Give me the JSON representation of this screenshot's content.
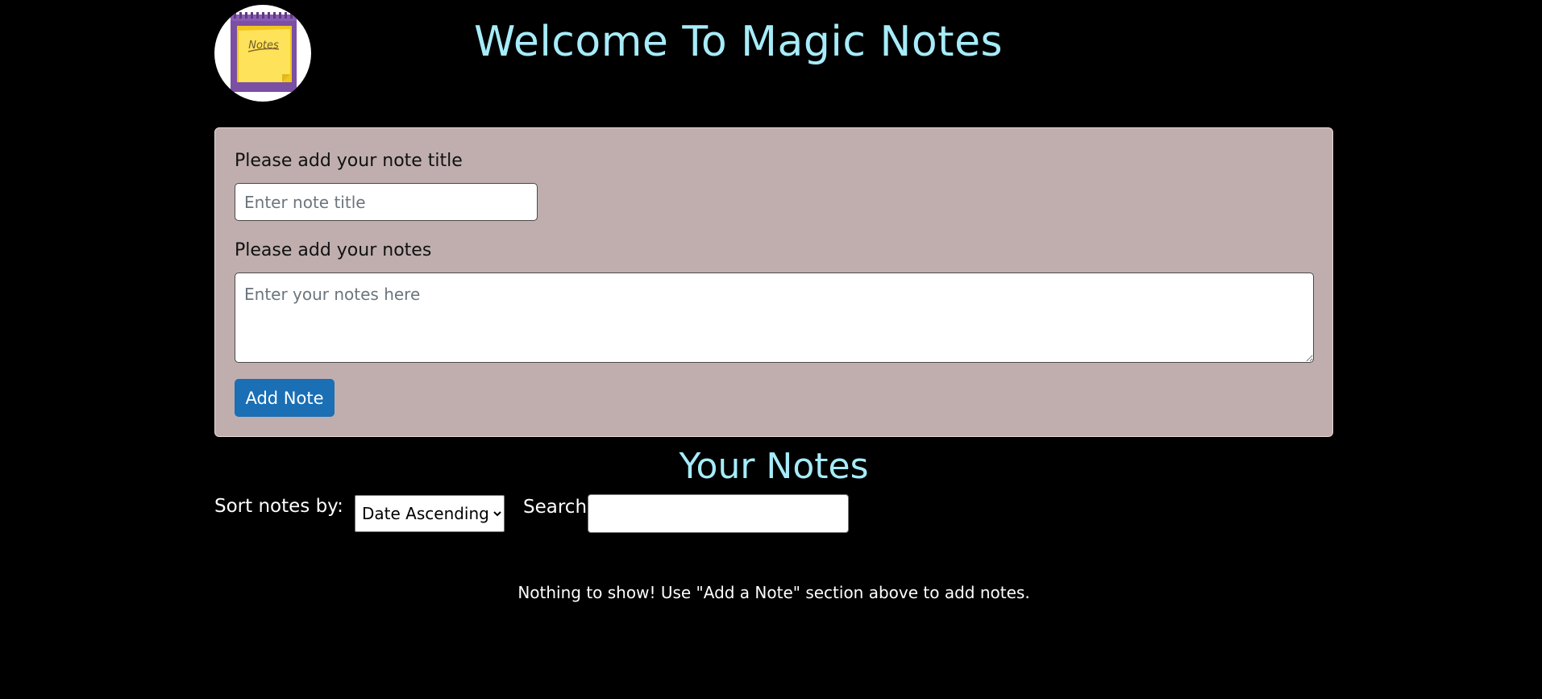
{
  "header": {
    "logo_icon": "notepad-icon",
    "logo_text": "Notes",
    "title": "Welcome To Magic Notes"
  },
  "form": {
    "title_label": "Please add your note title",
    "title_placeholder": "Enter note title",
    "title_value": "",
    "notes_label": "Please add your notes",
    "notes_placeholder": "Enter your notes here",
    "notes_value": "",
    "add_button_label": "Add Note"
  },
  "notes_section": {
    "title": "Your Notes",
    "sort_label": "Sort notes by:",
    "sort_selected": "Date Ascending",
    "search_label": "Search",
    "search_value": "",
    "empty_message": "Nothing to show! Use \"Add a Note\" section above to add notes."
  },
  "colors": {
    "page_background": "#000000",
    "title_color": "#a6ecf9",
    "form_background": "#c0aeae",
    "button_color": "#1a6fb5"
  }
}
